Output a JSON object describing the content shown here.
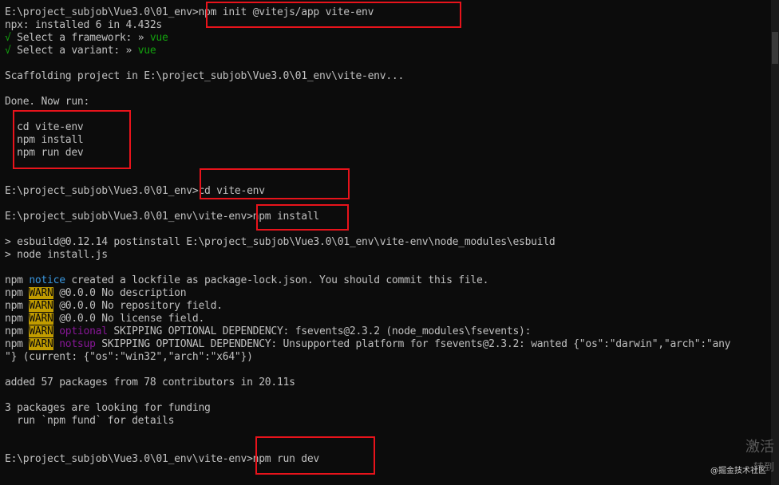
{
  "terminal": {
    "lines": {
      "l1_prompt": "E:\\project_subjob\\Vue3.0\\01_env>",
      "l1_cmd": "npm init @vitejs/app vite-env",
      "l2": "npx: installed 6 in 4.432s",
      "l3_check": "√",
      "l3_text": " Select a framework: » ",
      "l3_val": "vue",
      "l4_check": "√",
      "l4_text": " Select a variant: » ",
      "l4_val": "vue",
      "l5": "Scaffolding project in E:\\project_subjob\\Vue3.0\\01_env\\vite-env...",
      "l6": "Done. Now run:",
      "l7": "  cd vite-env",
      "l8": "  npm install",
      "l9": "  npm run dev",
      "l10_prompt": "E:\\project_subjob\\Vue3.0\\01_env>",
      "l10_cmd": "cd vite-env",
      "l11_prompt": "E:\\project_subjob\\Vue3.0\\01_env\\vite-env>",
      "l11_cmd": "npm install",
      "l12": "> esbuild@0.12.14 postinstall E:\\project_subjob\\Vue3.0\\01_env\\vite-env\\node_modules\\esbuild",
      "l13": "> node install.js",
      "l14_npm": "npm ",
      "l14_notice": "notice",
      "l14_text": " created a lockfile as package-lock.json. You should commit this file.",
      "l15_npm": "npm ",
      "l15_warn": "WARN",
      "l15_text": " @0.0.0 No description",
      "l16_npm": "npm ",
      "l16_warn": "WARN",
      "l16_text": " @0.0.0 No repository field.",
      "l17_npm": "npm ",
      "l17_warn": "WARN",
      "l17_text": " @0.0.0 No license field.",
      "l18_npm": "npm ",
      "l18_warn": "WARN",
      "l18_opt": " optional",
      "l18_text": " SKIPPING OPTIONAL DEPENDENCY: fsevents@2.3.2 (node_modules\\fsevents):",
      "l19_npm": "npm ",
      "l19_warn": "WARN",
      "l19_opt": " notsup",
      "l19_text": " SKIPPING OPTIONAL DEPENDENCY: Unsupported platform for fsevents@2.3.2: wanted {\"os\":\"darwin\",\"arch\":\"any",
      "l20": "\"} (current: {\"os\":\"win32\",\"arch\":\"x64\"})",
      "l21": "added 57 packages from 78 contributors in 20.11s",
      "l22": "3 packages are looking for funding",
      "l23": "  run `npm fund` for details",
      "l24_prompt": "E:\\project_subjob\\Vue3.0\\01_env\\vite-env>",
      "l24_cmd": "npm run dev"
    }
  },
  "watermark": {
    "line1": "激活",
    "line2": "转到",
    "line3": "@掘金技术社区"
  },
  "colors": {
    "background": "#0c0c0c",
    "text": "#c0c0c0",
    "success": "#13a10e",
    "warn_bg": "#c19c00",
    "notice": "#3a96dd",
    "optional": "#881798",
    "annotation_box": "#e8131b"
  }
}
